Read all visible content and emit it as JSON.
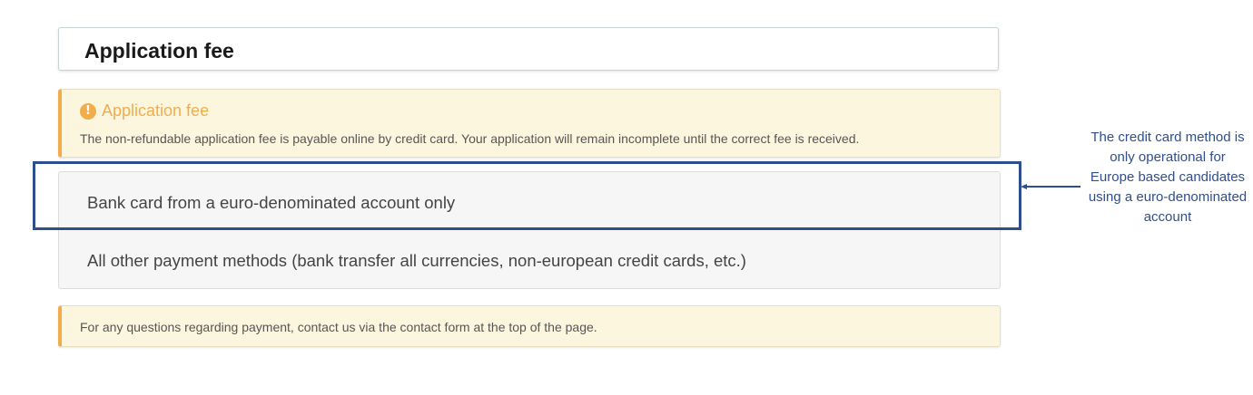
{
  "header": {
    "title": "Application fee"
  },
  "warning": {
    "icon": "exclamation-circle-icon",
    "icon_glyph": "!",
    "title": "Application fee",
    "text": "The non-refundable application fee is payable online by credit card. Your application will remain incomplete until the correct fee is received."
  },
  "options": [
    {
      "label": "Bank card from a euro-denominated account only"
    },
    {
      "label": "All other payment methods (bank transfer all currencies, non-european credit cards, etc.)"
    }
  ],
  "info": {
    "text": "For any questions regarding payment, contact us via the contact form at the top of the page."
  },
  "annotation": {
    "text": "The credit card method is only operational for Europe based candidates using a euro-denominated account",
    "color": "#2f4f8c"
  },
  "colors": {
    "accent": "#f0ad4e",
    "warning_bg": "#fdf6df",
    "highlight": "#2f4f8c"
  }
}
